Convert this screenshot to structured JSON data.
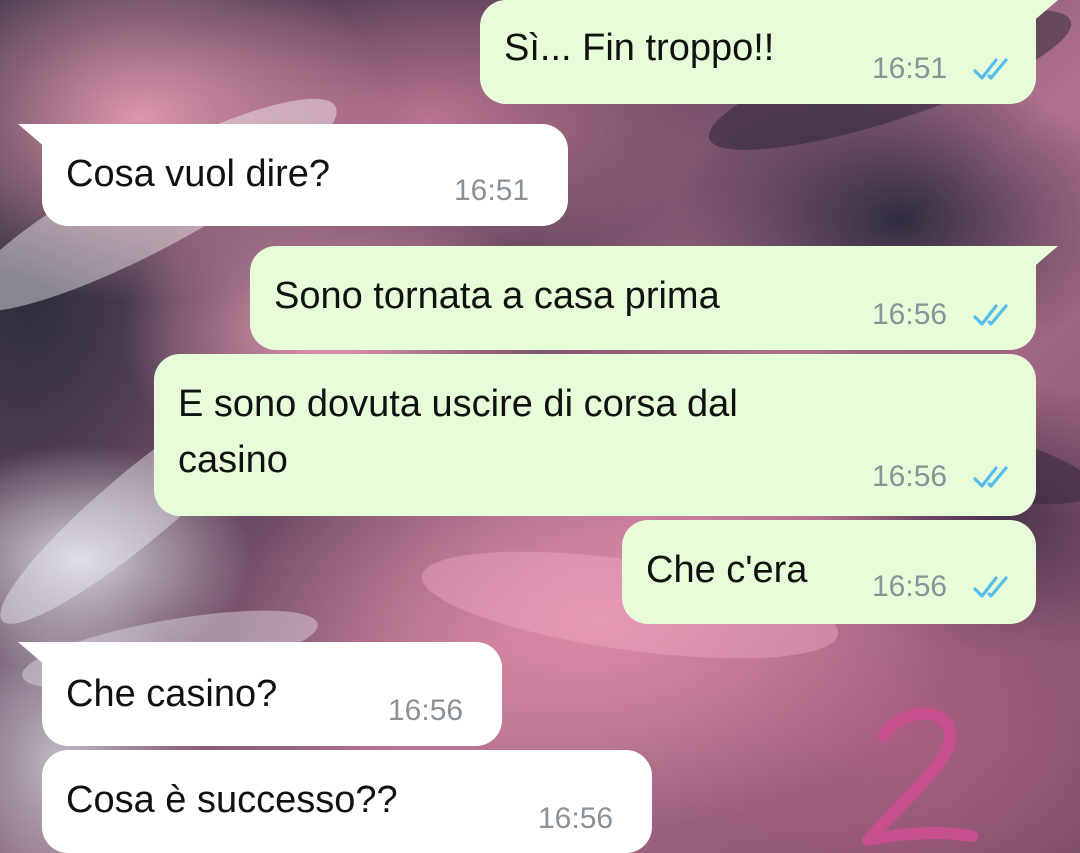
{
  "messages": [
    {
      "direction": "outgoing",
      "text": "Sì... Fin troppo!!",
      "time": "16:51",
      "status": "read"
    },
    {
      "direction": "incoming",
      "text": "Cosa vuol dire?",
      "time": "16:51"
    },
    {
      "direction": "outgoing",
      "text": "Sono tornata a casa prima",
      "time": "16:56",
      "status": "read"
    },
    {
      "direction": "outgoing",
      "text_lines": [
        "E sono dovuta uscire di corsa dal",
        "casino"
      ],
      "time": "16:56",
      "status": "read"
    },
    {
      "direction": "outgoing",
      "text": "Che c'era",
      "time": "16:56",
      "status": "read"
    },
    {
      "direction": "incoming",
      "text": "Che casino?",
      "time": "16:56"
    },
    {
      "direction": "incoming",
      "text": "Cosa è successo??",
      "time": "16:56"
    }
  ],
  "overlay_mark": "2",
  "colors": {
    "outgoing_bubble": "#e7fdd9",
    "incoming_bubble": "#ffffff",
    "read_ticks": "#53bdeb",
    "timestamp": "#8a9197",
    "overlay_mark": "#c9508e"
  },
  "icons": {
    "read_status": "double-check-icon"
  }
}
